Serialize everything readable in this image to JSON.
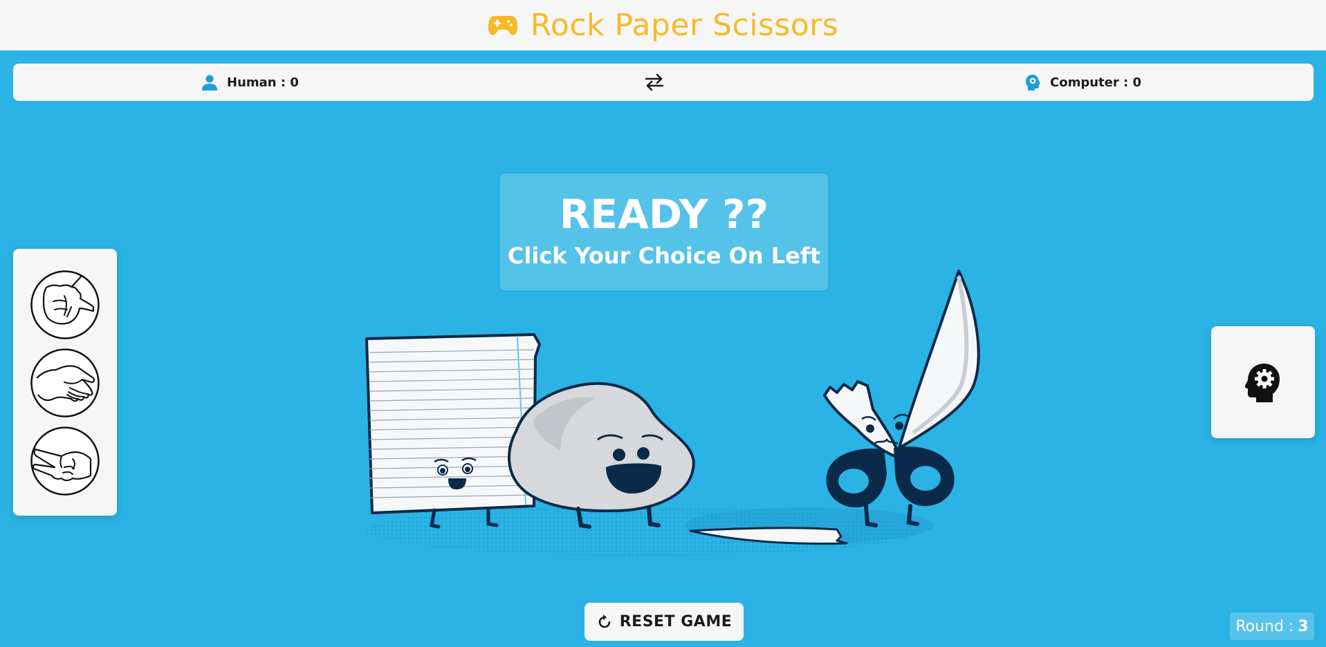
{
  "header": {
    "title": "Rock Paper Scissors",
    "icon": "gamepad-icon",
    "title_color": "#f9b927"
  },
  "scores": {
    "human": {
      "label": "Human : 0",
      "icon": "user-icon"
    },
    "swap_icon": "swap-arrows-icon",
    "computer": {
      "label": "Computer : 0",
      "icon": "robot-head-icon"
    }
  },
  "banner": {
    "title": "READY ??",
    "subtitle": "Click Your Choice On Left"
  },
  "choices": [
    {
      "name": "rock",
      "icon": "fist-icon"
    },
    {
      "name": "paper",
      "icon": "open-hand-icon"
    },
    {
      "name": "scissors",
      "icon": "peace-hand-icon"
    }
  ],
  "computer_panel": {
    "icon": "head-gear-icon"
  },
  "reset": {
    "label": "RESET GAME",
    "icon": "refresh-icon"
  },
  "round": {
    "label": "Round :",
    "value": "3"
  },
  "colors": {
    "background": "#2ab3e4",
    "panel": "#f6f6f6",
    "accent": "#f9b927",
    "navy": "#0b2a4a"
  }
}
